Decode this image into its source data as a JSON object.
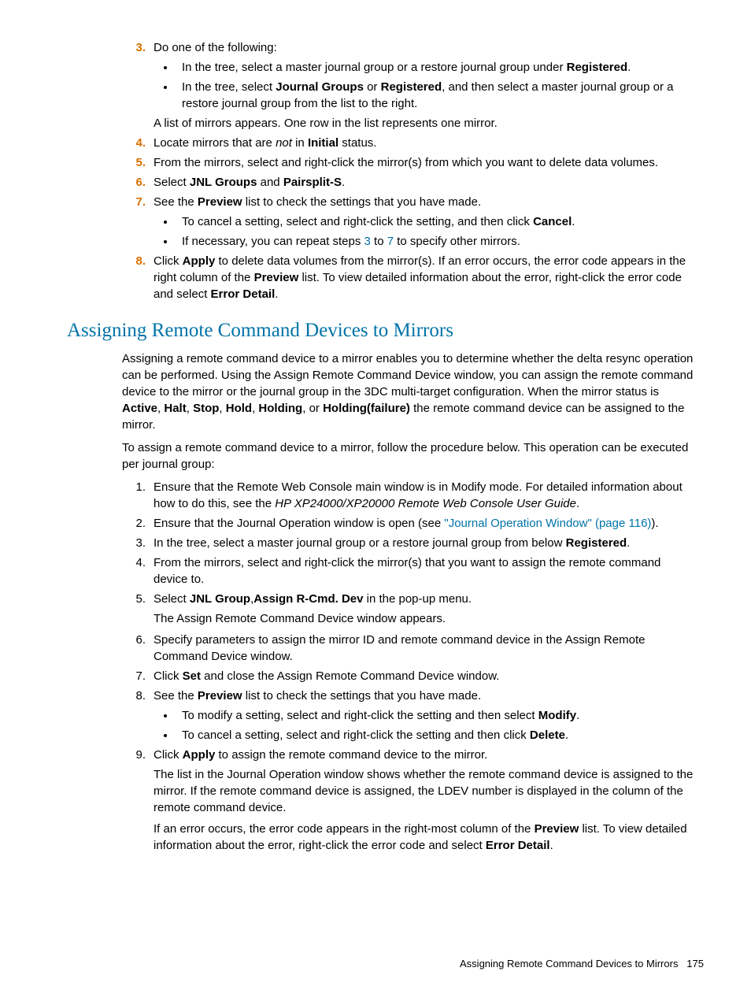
{
  "section1": {
    "step3": {
      "num": "3.",
      "text": "Do one of the following:",
      "bullet1_a": "In the tree, select a master journal group or a restore journal group under ",
      "bullet1_b": "Registered",
      "bullet1_c": ".",
      "bullet2_a": "In the tree, select ",
      "bullet2_b": "Journal Groups",
      "bullet2_c": " or ",
      "bullet2_d": "Registered",
      "bullet2_e": ", and then select a master journal group or a restore journal group from the list to the right.",
      "after": "A list of mirrors appears. One row in the list represents one mirror."
    },
    "step4": {
      "num": "4.",
      "a": "Locate mirrors that are ",
      "b": "not",
      "c": " in ",
      "d": "Initial",
      "e": " status."
    },
    "step5": {
      "num": "5.",
      "text": "From the mirrors, select and right-click the mirror(s) from which you want to delete data volumes."
    },
    "step6": {
      "num": "6.",
      "a": "Select ",
      "b": "JNL Groups",
      "c": " and ",
      "d": "Pairsplit-S",
      "e": "."
    },
    "step7": {
      "num": "7.",
      "a": "See the ",
      "b": "Preview",
      "c": " list to check the settings that you have made.",
      "bullet1_a": "To cancel a setting, select and right-click the setting, and then click ",
      "bullet1_b": "Cancel",
      "bullet1_c": ".",
      "bullet2_a": "If necessary, you can repeat steps ",
      "bullet2_link1": "3",
      "bullet2_b": " to ",
      "bullet2_link2": "7",
      "bullet2_c": " to specify other mirrors."
    },
    "step8": {
      "num": "8.",
      "a": "Click ",
      "b": "Apply",
      "c": " to delete data volumes from the mirror(s). If an error occurs, the error code appears in the right column of the ",
      "d": "Preview",
      "e": " list. To view detailed information about the error, right-click the error code and select ",
      "f": "Error Detail",
      "g": "."
    }
  },
  "heading": "Assigning Remote Command Devices to Mirrors",
  "section2": {
    "intro1_a": "Assigning a remote command device to a mirror enables you to determine whether the delta resync operation can be performed. Using the Assign Remote Command Device window, you can assign the remote command device to the mirror or the journal group in the 3DC multi-target configuration. When the mirror status is ",
    "intro1_b": "Active",
    "intro1_c": ", ",
    "intro1_d": "Halt",
    "intro1_e": ", ",
    "intro1_f": "Stop",
    "intro1_g": ", ",
    "intro1_h": "Hold",
    "intro1_i": ", ",
    "intro1_j": "Holding",
    "intro1_k": ", or ",
    "intro1_l": "Holding(failure)",
    "intro1_m": " the remote command device can be assigned to the mirror.",
    "intro2": "To assign a remote command device to a mirror, follow the procedure below. This operation can be executed per journal group:",
    "step1": {
      "num": "1.",
      "a": "Ensure that the Remote Web Console main window is in Modify mode. For detailed information about how to do this, see the ",
      "b": "HP XP24000/XP20000 Remote Web Console User Guide",
      "c": "."
    },
    "step2": {
      "num": "2.",
      "a": "Ensure that the Journal Operation window is open (see ",
      "link": "\"Journal Operation Window\" (page 116)",
      "b": ")."
    },
    "step3": {
      "num": "3.",
      "a": "In the tree, select a master journal group or a restore journal group from below ",
      "b": "Registered",
      "c": "."
    },
    "step4": {
      "num": "4.",
      "text": "From the mirrors, select and right-click the mirror(s) that you want to assign the remote command device to."
    },
    "step5": {
      "num": "5.",
      "a": "Select ",
      "b": "JNL Group",
      "c": ",",
      "d": "Assign R-Cmd. Dev",
      "e": " in the pop-up menu.",
      "after": "The Assign Remote Command Device window appears."
    },
    "step6": {
      "num": "6.",
      "text": "Specify parameters to assign the mirror ID and remote command device in the Assign Remote Command Device window."
    },
    "step7": {
      "num": "7.",
      "a": "Click ",
      "b": "Set",
      "c": " and close the Assign Remote Command Device window."
    },
    "step8": {
      "num": "8.",
      "a": "See the ",
      "b": "Preview",
      "c": " list to check the settings that you have made.",
      "bullet1_a": "To modify a setting, select and right-click the setting and then select ",
      "bullet1_b": "Modify",
      "bullet1_c": ".",
      "bullet2_a": "To cancel a setting, select and right-click the setting and then click ",
      "bullet2_b": "Delete",
      "bullet2_c": "."
    },
    "step9": {
      "num": "9.",
      "a": "Click ",
      "b": "Apply",
      "c": " to assign the remote command device to the mirror.",
      "after1": "The list in the Journal Operation window shows whether the remote command device is assigned to the mirror. If the remote command device is assigned, the LDEV number is displayed in the column of the remote command device.",
      "after2_a": "If an error occurs, the error code appears in the right-most column of the ",
      "after2_b": "Preview",
      "after2_c": " list. To view detailed information about the error, right-click the error code and select ",
      "after2_d": "Error Detail",
      "after2_e": "."
    }
  },
  "footer": {
    "title": "Assigning Remote Command Devices to Mirrors",
    "page": "175"
  }
}
